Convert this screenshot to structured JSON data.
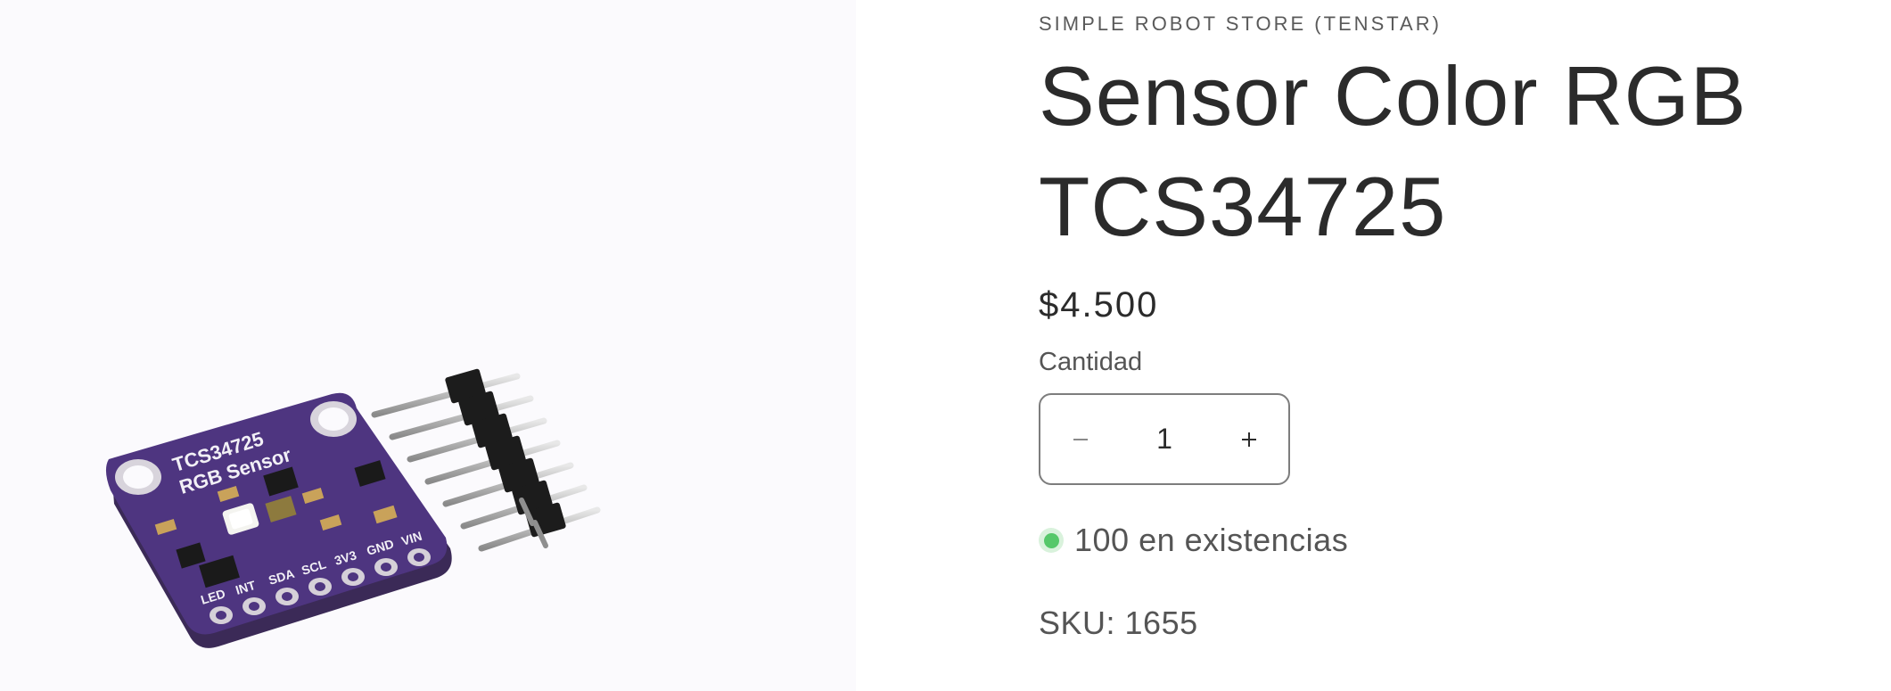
{
  "product": {
    "vendor": "SIMPLE ROBOT STORE (TENSTAR)",
    "title": "Sensor Color RGB TCS34725",
    "price": "$4.500",
    "image": {
      "board_title": "TCS34725",
      "board_subtitle": "RGB Sensor",
      "pin_labels": [
        "LED",
        "INT",
        "SDA",
        "SCL",
        "3V3",
        "GND",
        "VIN"
      ]
    }
  },
  "quantity": {
    "label": "Cantidad",
    "value": "1",
    "decrease_icon": "minus-icon",
    "increase_icon": "plus-icon"
  },
  "stock": {
    "text": "100 en existencias",
    "status_color": "#56c86a"
  },
  "sku": {
    "text": "SKU: 1655"
  }
}
